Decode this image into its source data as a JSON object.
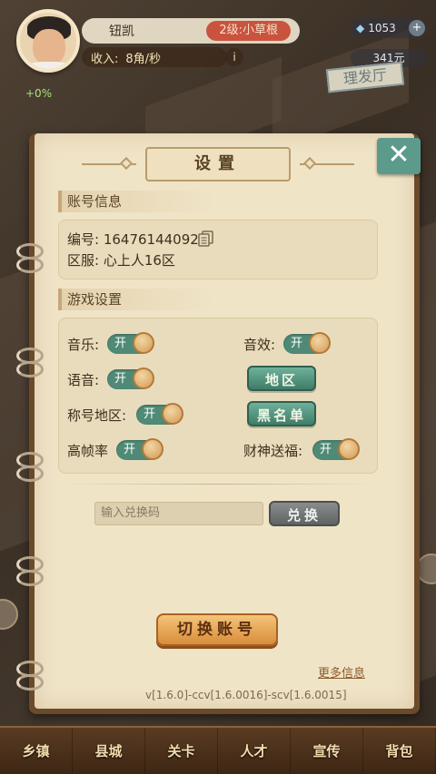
{
  "hud": {
    "player_name": "钮凯",
    "level_label": "2级:小草根",
    "income_label": "收入:",
    "income_rate": "8角/秒",
    "info_label": "i",
    "gems": "1053",
    "gem_plus": "+",
    "cash": "341元",
    "shop_sign": "理发厅",
    "bonus": "+0%"
  },
  "settings": {
    "title": "设置",
    "close_label": "✕",
    "account_section": "账号信息",
    "account_id_label": "编号: 16476144092",
    "server_label": "区服: 心上人16区",
    "game_section": "游戏设置",
    "music_label": "音乐:",
    "sfx_label": "音效:",
    "voice_label": "语音:",
    "region_button": "地区",
    "title_region_label": "称号地区:",
    "blacklist_button": "黑名单",
    "high_fps_label": "高帧率",
    "fortune_label": "财神送福:",
    "toggle_on": "开",
    "redeem_placeholder": "输入兑换码",
    "redeem_button": "兑换",
    "switch_account_button": "切换账号",
    "more_info_link": "更多信息",
    "version": "v[1.6.0]-ccv[1.6.0016]-scv[1.6.0015]"
  },
  "nav": {
    "items": [
      "乡镇",
      "县城",
      "关卡",
      "人才",
      "宣传",
      "背包"
    ]
  },
  "colors": {
    "paper": "#f0e4c7",
    "toggle_on": "#4f8a76",
    "switch_button": "#e3a052"
  }
}
